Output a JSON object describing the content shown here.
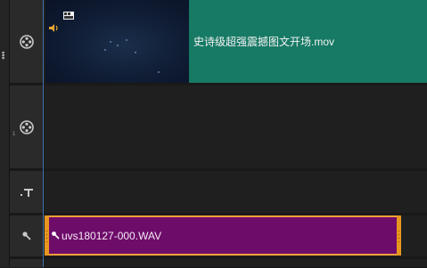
{
  "tracks": {
    "video_clip": {
      "filename": "史诗级超强震撼图文开场.mov"
    },
    "track2": {
      "index": "1"
    },
    "audio_clip": {
      "filename": "uvs180127-000.WAV"
    }
  },
  "icons": {
    "video_track": "film-reel-icon",
    "overlay_track": "film-reel-icon",
    "title_track": "title-text-icon",
    "audio_track": "audio-pin-icon",
    "thumb_badge": "video-thumbnail-icon",
    "thumb_audio": "speaker-icon",
    "clip_audio": "audio-clip-icon",
    "grip": "drag-grip-icon"
  },
  "colors": {
    "video_clip": "#177a65",
    "audio_clip": "#6e0c6a",
    "audio_handle": "#e7961f",
    "playhead": "#3f6fae"
  }
}
